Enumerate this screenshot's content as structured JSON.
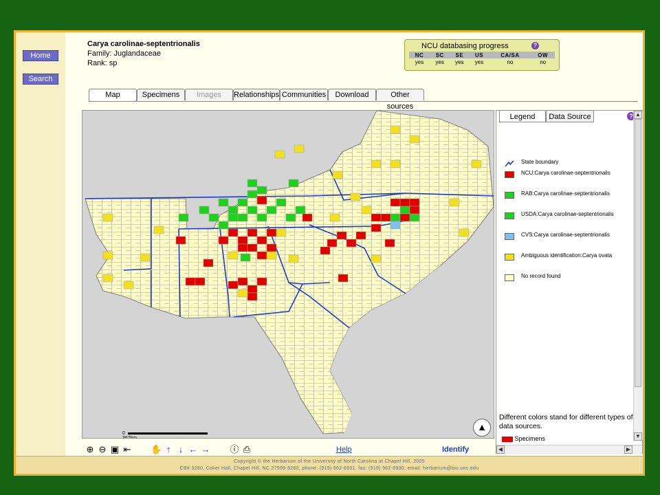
{
  "header": {
    "species": "Carya carolinae-septentrionalis",
    "family": "Family: Juglandaceae",
    "rank": "Rank: sp"
  },
  "sidebar": {
    "items": [
      {
        "label": "Home"
      },
      {
        "label": "Search"
      }
    ]
  },
  "progress": {
    "title": "NCU databasing progress",
    "help": "?",
    "columns": [
      "NC",
      "SC",
      "SE",
      "US",
      "CA/SA",
      "OW"
    ],
    "values": [
      "yes",
      "yes",
      "yes",
      "yes",
      "no",
      "no"
    ]
  },
  "tabs": [
    {
      "label": "Map",
      "active": true
    },
    {
      "label": "Specimens"
    },
    {
      "label": "Images",
      "disabled": true
    },
    {
      "label": "Relationships"
    },
    {
      "label": "Communities"
    },
    {
      "label": "Download"
    },
    {
      "label": "Other sources"
    }
  ],
  "map": {
    "scale_start": "0",
    "scale_end": "367km",
    "north": "N"
  },
  "toolbar": {
    "help_label": "Help",
    "identify_label": "Identify"
  },
  "rpanel": {
    "tabs": [
      {
        "label": "Legend"
      },
      {
        "label": "Data Source"
      }
    ],
    "help": "?",
    "legend": [
      {
        "label": "State boundary",
        "color": "#1a3ec8",
        "kind": "line"
      },
      {
        "label": "NCU:Carya carolinae-septentrionalis",
        "color": "#e00000"
      },
      {
        "label": "RAB:Carya carolinae-septentrionalis",
        "color": "#20d020"
      },
      {
        "label": "USDA:Carya carolinae-septentrionalis",
        "color": "#20d020"
      },
      {
        "label": "CVS:Carya carolinae-septentrionalis",
        "color": "#80c0f0"
      },
      {
        "label": "Ambiguous identification:Carya ovata",
        "color": "#f0e020"
      },
      {
        "label": "No record found",
        "color": "#fffcc8"
      }
    ],
    "note": "Different colors stand for different types of data sources.",
    "specimens_label": "Specimens"
  },
  "footer": {
    "line1": "Copyright © the Herbarium of the University of North Carolina at Chapel Hill, 2005",
    "line2": "CB# 3280, Coker Hall, Chapel Hill, NC 27599-3280, phone: (919) 962-6931, fax: (919) 962-6930, email: herbarium@bio.unc.edu"
  },
  "colors": {
    "background": "#146414",
    "border": "#f0b030",
    "no_record": "#fffcc8",
    "ncu": "#e00000",
    "green": "#20d020",
    "ambiguous": "#f0e020"
  }
}
